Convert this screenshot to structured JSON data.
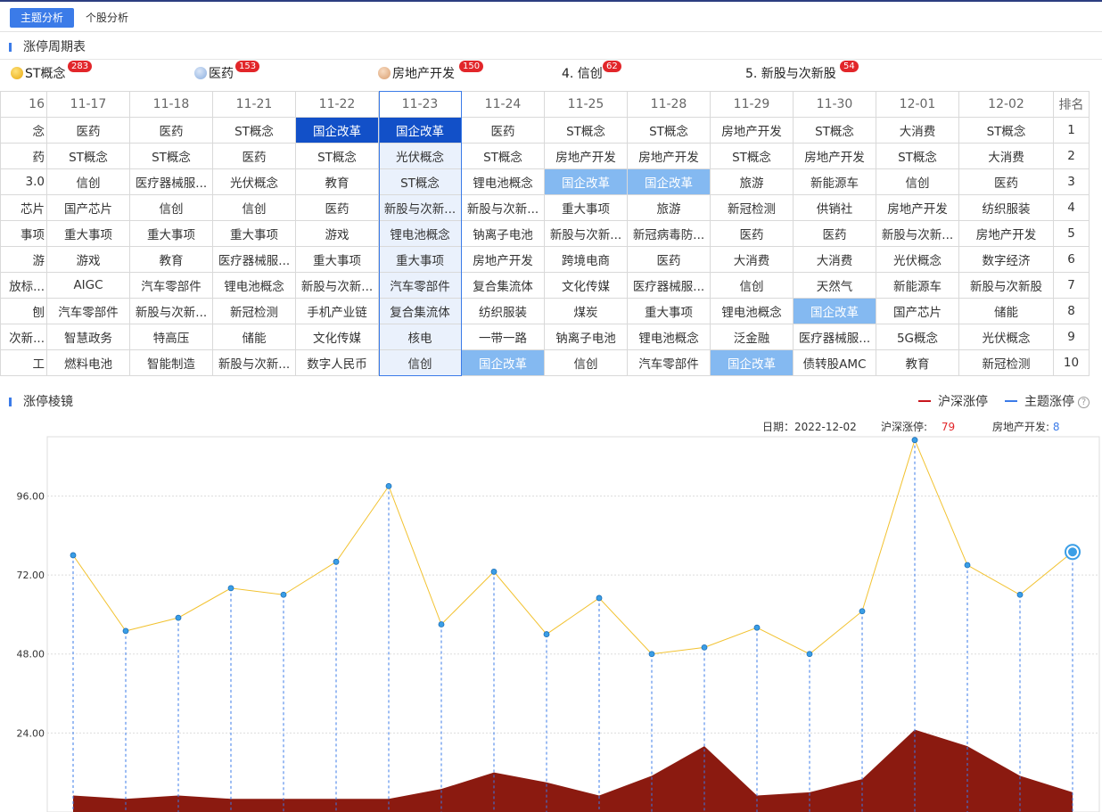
{
  "tabs": [
    {
      "label": "主题分析",
      "active": true
    },
    {
      "label": "个股分析",
      "active": false
    }
  ],
  "section1_title": "涨停周期表",
  "top_themes": [
    {
      "label": "ST概念",
      "count": "283",
      "medal": "#f2c230"
    },
    {
      "label": "医药",
      "count": "153",
      "medal": "#9fbce6"
    },
    {
      "label": "房地产开发",
      "count": "150",
      "medal": "#e8bb93"
    },
    {
      "label": "4. 信创",
      "count": "62"
    },
    {
      "label": "5. 新股与次新股",
      "count": "54"
    }
  ],
  "table": {
    "rank_header": "排名",
    "dates": [
      "16",
      "11-17",
      "11-18",
      "11-21",
      "11-22",
      "11-23",
      "11-24",
      "11-25",
      "11-28",
      "11-29",
      "11-30",
      "12-01",
      "12-02"
    ],
    "rows": [
      [
        "念",
        "医药",
        "医药",
        "ST概念",
        "国企改革",
        "国企改革",
        "医药",
        "ST概念",
        "ST概念",
        "房地产开发",
        "ST概念",
        "大消费",
        "ST概念"
      ],
      [
        "药",
        "ST概念",
        "ST概念",
        "医药",
        "ST概念",
        "光伏概念",
        "ST概念",
        "房地产开发",
        "房地产开发",
        "ST概念",
        "房地产开发",
        "ST概念",
        "大消费"
      ],
      [
        "3.0",
        "信创",
        "医疗器械服...",
        "光伏概念",
        "教育",
        "ST概念",
        "锂电池概念",
        "国企改革",
        "国企改革",
        "旅游",
        "新能源车",
        "信创",
        "医药"
      ],
      [
        "芯片",
        "国产芯片",
        "信创",
        "信创",
        "医药",
        "新股与次新...",
        "新股与次新...",
        "重大事项",
        "旅游",
        "新冠检测",
        "供销社",
        "房地产开发",
        "纺织服装"
      ],
      [
        "事项",
        "重大事项",
        "重大事项",
        "重大事项",
        "游戏",
        "锂电池概念",
        "钠离子电池",
        "新股与次新...",
        "新冠病毒防...",
        "医药",
        "医药",
        "新股与次新...",
        "房地产开发"
      ],
      [
        "游",
        "游戏",
        "教育",
        "医疗器械服...",
        "重大事项",
        "重大事项",
        "房地产开发",
        "跨境电商",
        "医药",
        "大消费",
        "大消费",
        "光伏概念",
        "数字经济"
      ],
      [
        "放标...",
        "AIGC",
        "汽车零部件",
        "锂电池概念",
        "新股与次新...",
        "汽车零部件",
        "复合集流体",
        "文化传媒",
        "医疗器械服...",
        "信创",
        "天然气",
        "新能源车",
        "新股与次新股"
      ],
      [
        "刨",
        "汽车零部件",
        "新股与次新...",
        "新冠检测",
        "手机产业链",
        "复合集流体",
        "纺织服装",
        "煤炭",
        "重大事项",
        "锂电池概念",
        "国企改革",
        "国产芯片",
        "储能"
      ],
      [
        "次新...",
        "智慧政务",
        "特高压",
        "储能",
        "文化传媒",
        "核电",
        "一带一路",
        "钠离子电池",
        "锂电池概念",
        "泛金融",
        "医疗器械服...",
        "5G概念",
        "光伏概念"
      ],
      [
        "工",
        "燃料电池",
        "智能制造",
        "新股与次新...",
        "数字人民币",
        "信创",
        "国企改革",
        "信创",
        "汽车零部件",
        "国企改革",
        "债转股AMC",
        "教育",
        "新冠检测"
      ]
    ],
    "ranks": [
      "1",
      "2",
      "3",
      "4",
      "5",
      "6",
      "7",
      "8",
      "9",
      "10"
    ]
  },
  "section2_title": "涨停棱镜",
  "legend": {
    "market": "沪深涨停",
    "theme": "主题涨停",
    "help": "?"
  },
  "info": {
    "date_label": "日期：",
    "date_value": "2022-12-02",
    "market_label": "沪深涨停:",
    "market_value": "79",
    "theme_label": "房地产开发:",
    "theme_value": "8"
  },
  "colors": {
    "accent": "#3b7be8",
    "highlight_dark": "#1250c8",
    "highlight_light": "#84b9f1",
    "market_line": "#f2c230",
    "market_point": "#3a9ee6",
    "area": "#8b1a10",
    "badge": "#e2262a"
  },
  "chart_data": {
    "type": "line",
    "y_ticks": [
      "24.00",
      "48.00",
      "72.00",
      "96.00"
    ],
    "ylim": [
      0,
      114
    ],
    "series": [
      {
        "name": "沪深涨停",
        "values": [
          78,
          55,
          59,
          68,
          66,
          76,
          99,
          57,
          73,
          54,
          65,
          48,
          50,
          56,
          48,
          61,
          113,
          75,
          66,
          79
        ]
      },
      {
        "name": "主题涨停",
        "values": [
          5,
          4,
          5,
          4,
          4,
          4,
          4,
          7,
          12,
          9,
          5,
          11,
          20,
          5,
          6,
          10,
          25,
          20,
          11,
          6
        ]
      }
    ]
  }
}
